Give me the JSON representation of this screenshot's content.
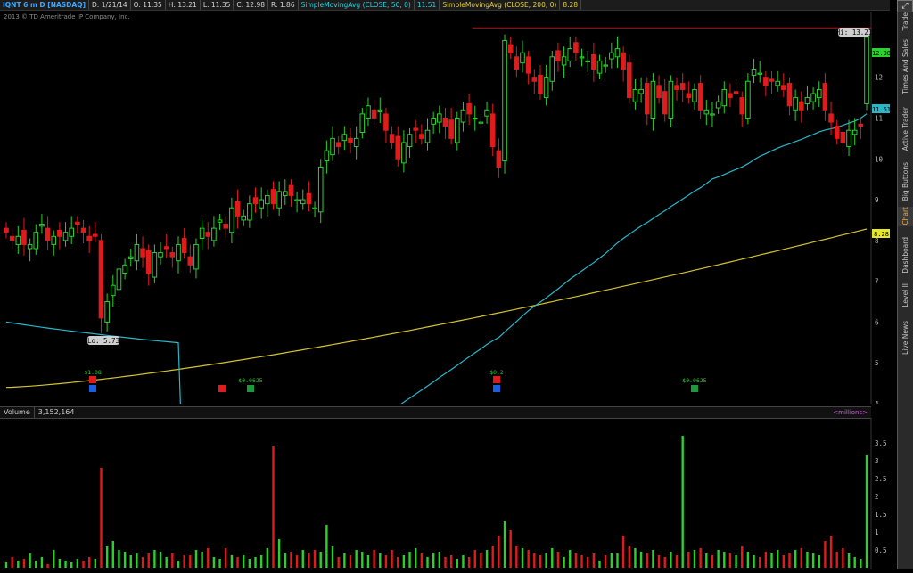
{
  "header": {
    "symbol": "IQNT 6 m D [NASDAQ]",
    "date": "D: 1/21/14",
    "open": "O: 11.35",
    "high": "H: 13.21",
    "low": "L: 11.35",
    "close": "C: 12.98",
    "range": "R: 1.86",
    "sma50_label": "SimpleMovingAvg (CLOSE, 50, 0)",
    "sma50_value": "11.51",
    "sma200_label": "SimpleMovingAvg (CLOSE, 200, 0)",
    "sma200_value": "8.28"
  },
  "copyright": "2013 © TD Ameritrade IP Company, Inc.",
  "price_axis": [
    "12",
    "11",
    "10",
    "9",
    "8",
    "7",
    "6",
    "5",
    "4"
  ],
  "badges": {
    "hi": "Hi: 13.21",
    "lo": "Lo: 5.73",
    "last": "12.98",
    "sma50": "11.51",
    "sma200": "8.28"
  },
  "events": {
    "div1": "$1.08",
    "div2": "$0.0625",
    "div3": "$0.2",
    "div4": "$0.0625"
  },
  "volume": {
    "label": "Volume",
    "value": "3,152,164",
    "units": "<millions>",
    "axis": [
      "3.5",
      "3",
      "2.5",
      "2",
      "1.5",
      "1",
      "0.5"
    ]
  },
  "right_tabs": [
    "Trade",
    "Times And Sales",
    "Active Trader",
    "Big Buttons",
    "Chart",
    "Dashboard",
    "Level II",
    "Live News"
  ],
  "colors": {
    "up": "#2bd12b",
    "down": "#e01b1b",
    "sma50": "#27b7c9",
    "sma200": "#d4c230",
    "hi_line": "#b01a1a"
  },
  "chart_data": {
    "type": "candlestick",
    "symbol": "IQNT",
    "ylim": [
      4,
      13.5
    ],
    "closes": [
      8.2,
      8.0,
      8.1,
      7.9,
      7.9,
      8.2,
      8.4,
      8.0,
      8.1,
      8.1,
      8.2,
      8.3,
      8.4,
      8.2,
      8.0,
      8.1,
      6.1,
      6.5,
      6.9,
      7.3,
      7.4,
      7.6,
      7.9,
      7.6,
      7.2,
      7.7,
      7.7,
      7.8,
      7.6,
      7.9,
      7.7,
      7.4,
      7.9,
      8.3,
      8.1,
      8.3,
      8.5,
      8.3,
      8.8,
      8.6,
      8.6,
      8.9,
      8.9,
      9.0,
      9.1,
      8.9,
      9.2,
      9.2,
      9.1,
      9.0,
      9.0,
      8.9,
      8.8,
      9.8,
      10.2,
      10.5,
      10.3,
      10.6,
      10.4,
      10.5,
      11.1,
      11.3,
      11.0,
      11.2,
      10.7,
      10.4,
      10.0,
      10.4,
      10.6,
      10.7,
      10.5,
      10.7,
      11.0,
      11.1,
      10.8,
      10.5,
      11.0,
      11.2,
      11.1,
      11.0,
      10.9,
      11.2,
      10.3,
      9.8,
      12.9,
      12.6,
      12.2,
      12.6,
      12.1,
      11.9,
      11.6,
      12.0,
      12.5,
      12.4,
      12.5,
      12.7,
      12.6,
      12.5,
      12.4,
      12.2,
      12.4,
      12.3,
      12.6,
      12.7,
      12.2,
      11.5,
      11.7,
      11.7,
      11.1,
      11.9,
      11.5,
      11.1,
      11.9,
      11.7,
      11.7,
      11.5,
      11.7,
      11.2,
      11.2,
      11.1,
      11.4,
      11.7,
      11.5,
      11.6,
      11.1,
      11.9,
      12.2,
      12.1,
      11.8,
      11.9,
      11.9,
      11.7,
      11.3,
      11.5,
      11.2,
      11.5,
      11.6,
      11.7,
      11.2,
      10.9,
      10.5,
      10.4,
      10.7,
      10.7,
      10.8,
      12.98
    ],
    "sma50_start": 6.0,
    "sma50_end": 11.51,
    "sma200_start": 4.4,
    "sma200_end": 8.28,
    "high_line": 13.21,
    "volume_max": 3.5,
    "volume": [
      0.15,
      0.3,
      0.2,
      0.25,
      0.4,
      0.2,
      0.3,
      0.1,
      0.5,
      0.25,
      0.2,
      0.15,
      0.25,
      0.2,
      0.3,
      0.25,
      2.8,
      0.6,
      0.75,
      0.5,
      0.45,
      0.35,
      0.4,
      0.3,
      0.4,
      0.5,
      0.45,
      0.3,
      0.4,
      0.2,
      0.35,
      0.35,
      0.5,
      0.45,
      0.55,
      0.3,
      0.25,
      0.55,
      0.35,
      0.3,
      0.35,
      0.25,
      0.3,
      0.35,
      0.55,
      3.4,
      0.8,
      0.4,
      0.45,
      0.35,
      0.5,
      0.4,
      0.5,
      0.45,
      1.2,
      0.6,
      0.3,
      0.4,
      0.35,
      0.5,
      0.45,
      0.35,
      0.5,
      0.4,
      0.35,
      0.5,
      0.3,
      0.35,
      0.45,
      0.55,
      0.4,
      0.3,
      0.4,
      0.45,
      0.3,
      0.35,
      0.25,
      0.35,
      0.3,
      0.5,
      0.4,
      0.5,
      0.6,
      0.9,
      1.3,
      1.05,
      0.6,
      0.55,
      0.5,
      0.4,
      0.35,
      0.4,
      0.55,
      0.45,
      0.3,
      0.5,
      0.4,
      0.35,
      0.3,
      0.4,
      0.2,
      0.35,
      0.4,
      0.4,
      0.9,
      0.6,
      0.55,
      0.45,
      0.4,
      0.5,
      0.35,
      0.3,
      0.45,
      0.35,
      3.7,
      0.45,
      0.5,
      0.55,
      0.4,
      0.35,
      0.5,
      0.45,
      0.4,
      0.35,
      0.6,
      0.45,
      0.35,
      0.3,
      0.45,
      0.4,
      0.5,
      0.35,
      0.4,
      0.5,
      0.55,
      0.45,
      0.4,
      0.35,
      0.75,
      0.9,
      0.45,
      0.55,
      0.4,
      0.3,
      0.25,
      3.15
    ]
  }
}
